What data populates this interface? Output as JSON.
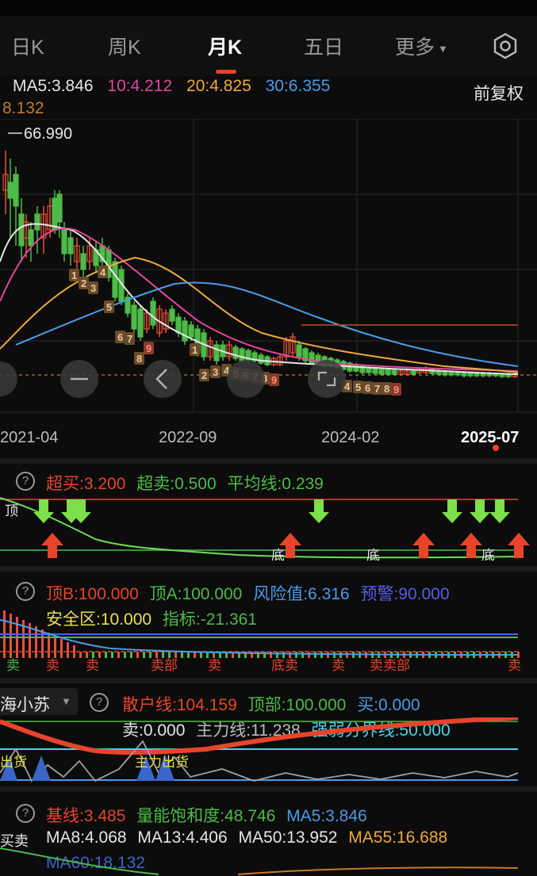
{
  "tabs": [
    "日K",
    "周K",
    "月K",
    "五日",
    "更多"
  ],
  "active_tab": "月K",
  "top_legend": {
    "ma5": "MA5:3.846",
    "ma10": "10:4.212",
    "ma20": "20:4.825",
    "ma30": "30:6.355",
    "extra": "8.132",
    "adjust": "前复权"
  },
  "price_chart": {
    "high_label": "66.990",
    "x_ticks": [
      "2021-04",
      "2022-09",
      "2024-02",
      "2025-07"
    ],
    "candle_numbers": [
      "1",
      "2",
      "3",
      "4",
      "5",
      "6",
      "7",
      "8",
      "9"
    ]
  },
  "indicator1": {
    "chao_mai": "超买:3.200",
    "chao_mai_sell": "超卖:0.500",
    "avg_line": "平均线:0.239",
    "top_label": "顶",
    "bottom_label": "底"
  },
  "indicator2": {
    "top_b": "顶B:100.000",
    "top_a": "顶A:100.000",
    "risk": "风险值:6.316",
    "warning": "预警:90.000",
    "safe": "安全区:10.000",
    "index": "指标:-21.361",
    "sell_labels": [
      "卖",
      "卖",
      "卖",
      "卖部",
      "卖",
      "底卖",
      "卖",
      "卖卖部",
      "卖"
    ]
  },
  "indicator3": {
    "selector": "海小苏",
    "retail": "散户线:104.159",
    "top": "顶部:100.000",
    "buy": "买:0.000",
    "sell": "卖:0.000",
    "main": "主力线:11.238",
    "boundary": "强弱分界线:50.000",
    "chart_labels": [
      "出货",
      "主力出货"
    ]
  },
  "indicator4": {
    "base": "基线:3.485",
    "saturation": "量能饱和度:48.746",
    "ma5": "MA5:3.846",
    "ma8": "MA8:4.068",
    "ma13": "MA13:4.406",
    "ma50": "MA50:13.952",
    "ma55": "MA55:16.688",
    "ma60": "MA60:18.132",
    "buy_sell": "买卖"
  },
  "colors": {
    "accent": "#e8442b",
    "up": "#e8503a",
    "down": "#4cbb47",
    "ma5": "#e6e6e6",
    "ma10": "#e0469e",
    "ma20": "#f0a83a",
    "ma30": "#4a9be8"
  }
}
